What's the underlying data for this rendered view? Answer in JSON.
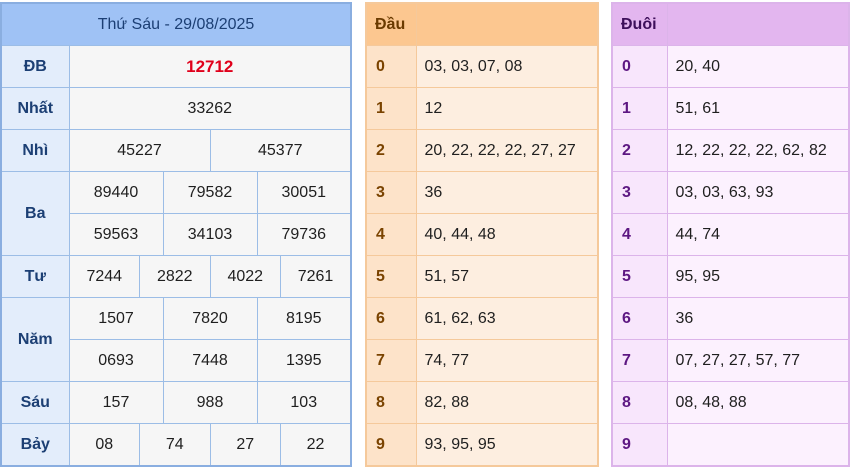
{
  "results": {
    "title": "Thứ Sáu - 29/08/2025",
    "rows": {
      "db": {
        "label": "ĐB",
        "values": [
          "12712"
        ]
      },
      "nhat": {
        "label": "Nhất",
        "values": [
          "33262"
        ]
      },
      "nhi": {
        "label": "Nhì",
        "values": [
          "45227",
          "45377"
        ]
      },
      "ba": {
        "label": "Ba",
        "values": [
          "89440",
          "79582",
          "30051",
          "59563",
          "34103",
          "79736"
        ]
      },
      "tu": {
        "label": "Tư",
        "values": [
          "7244",
          "2822",
          "4022",
          "7261"
        ]
      },
      "nam": {
        "label": "Năm",
        "values": [
          "1507",
          "7820",
          "8195",
          "0693",
          "7448",
          "1395"
        ]
      },
      "sau": {
        "label": "Sáu",
        "values": [
          "157",
          "988",
          "103"
        ]
      },
      "bay": {
        "label": "Bảy",
        "values": [
          "08",
          "74",
          "27",
          "22"
        ]
      }
    },
    "special_color": "#e0001b"
  },
  "head": {
    "title": "Đầu",
    "rows": [
      {
        "digit": "0",
        "numbers": "03, 03, 07, 08"
      },
      {
        "digit": "1",
        "numbers": "12"
      },
      {
        "digit": "2",
        "numbers": "20, 22, 22, 22, 27, 27"
      },
      {
        "digit": "3",
        "numbers": "36"
      },
      {
        "digit": "4",
        "numbers": "40, 44, 48"
      },
      {
        "digit": "5",
        "numbers": "51, 57"
      },
      {
        "digit": "6",
        "numbers": "61, 62, 63"
      },
      {
        "digit": "7",
        "numbers": "74, 77"
      },
      {
        "digit": "8",
        "numbers": "82, 88"
      },
      {
        "digit": "9",
        "numbers": "93, 95, 95"
      }
    ]
  },
  "tail": {
    "title": "Đuôi",
    "rows": [
      {
        "digit": "0",
        "numbers": "20, 40"
      },
      {
        "digit": "1",
        "numbers": "51, 61"
      },
      {
        "digit": "2",
        "numbers": "12, 22, 22, 22, 62, 82"
      },
      {
        "digit": "3",
        "numbers": "03, 03, 63, 93"
      },
      {
        "digit": "4",
        "numbers": "44, 74"
      },
      {
        "digit": "5",
        "numbers": "95, 95"
      },
      {
        "digit": "6",
        "numbers": "36"
      },
      {
        "digit": "7",
        "numbers": "07, 27, 27, 57, 77"
      },
      {
        "digit": "8",
        "numbers": "08, 48, 88"
      },
      {
        "digit": "9",
        "numbers": ""
      }
    ]
  }
}
